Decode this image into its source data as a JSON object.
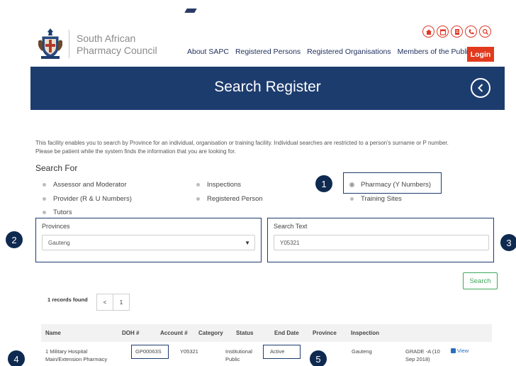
{
  "header": {
    "logo_line1": "South African",
    "logo_line2": "Pharmacy Council",
    "quick_icons": [
      "home-icon",
      "calendar-icon",
      "document-icon",
      "phone-icon",
      "search-icon"
    ],
    "nav": [
      "About SAPC",
      "Registered Persons",
      "Registered Organisations",
      "Members of the Public"
    ],
    "login_label": "Login"
  },
  "banner": {
    "title": "Search Register",
    "back_icon": "chevron-left-icon"
  },
  "search": {
    "intro_line1": "This facility enables you to search by Province for an individual, organisation or training facility. Individual searches are restricted to a person's surname or P number.",
    "intro_line2": "Please be patient while the system finds the information that you are looking for.",
    "heading": "Search For",
    "options": [
      "Assessor and Moderator",
      "Inspections",
      "Pharmacy (Y Numbers)",
      "Provider (R & U Numbers)",
      "Registered Person",
      "Training Sites",
      "Tutors"
    ],
    "selected_option": "Pharmacy (Y Numbers)",
    "provinces_label": "Provinces",
    "province_value": "Gauteng",
    "search_text_label": "Search Text",
    "search_text_value": "Y05321",
    "search_button": "Search"
  },
  "results": {
    "records_found": "1 records found",
    "pager": [
      "<",
      "1"
    ],
    "columns": [
      "Name",
      "DOH #",
      "Account #",
      "Category",
      "Status",
      "End Date",
      "Province",
      "Inspection"
    ],
    "rows": [
      {
        "name_line1": "1 Military Hospital",
        "name_line2": "Main/Extension Pharmacy",
        "doh": "GP00063S",
        "account": "Y05321",
        "category_line1": "Institutional",
        "category_line2": "Public",
        "status": "Active",
        "end_date": "",
        "province": "Gauteng",
        "inspection_line1": "GRADE -A (10",
        "inspection_line2": "Sep 2018)",
        "view_label": "View"
      }
    ]
  },
  "markers": [
    "1",
    "2",
    "3",
    "4",
    "5"
  ],
  "colors": {
    "banner": "#1d3c6e",
    "login": "#e23a1e",
    "search_button": "#3fa85a",
    "marker": "#0f2a50",
    "icon_red": "#e03a2a"
  }
}
